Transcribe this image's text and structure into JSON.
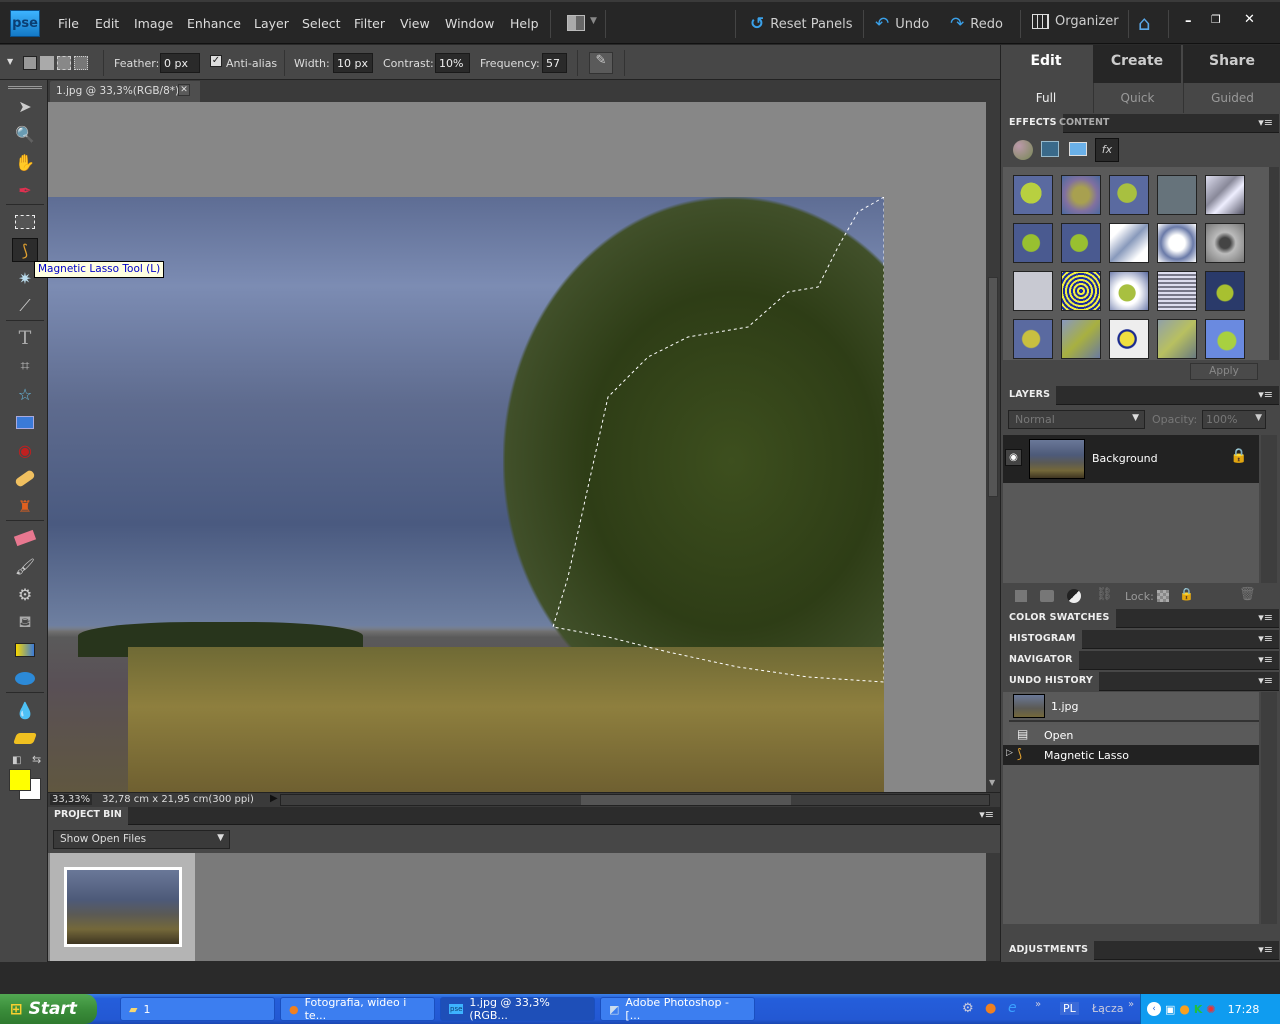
{
  "app": {
    "logo": "pse"
  },
  "menu": [
    "File",
    "Edit",
    "Image",
    "Enhance",
    "Layer",
    "Select",
    "Filter",
    "View",
    "Window",
    "Help"
  ],
  "toolbar": {
    "reset_panels": "Reset Panels",
    "undo": "Undo",
    "redo": "Redo",
    "organizer": "Organizer"
  },
  "options": {
    "feather_label": "Feather:",
    "feather_value": "0 px",
    "antialias_label": "Anti-alias",
    "antialias_checked": true,
    "width_label": "Width:",
    "width_value": "10 px",
    "contrast_label": "Contrast:",
    "contrast_value": "10%",
    "frequency_label": "Frequency:",
    "frequency_value": "57"
  },
  "document": {
    "tab_title": "1.jpg @ 33,3%(RGB/8*) *",
    "zoom": "33,33%",
    "doc_info": "32,78 cm x 21,95 cm(300 ppi)"
  },
  "tooltip": "Magnetic Lasso Tool  (L)",
  "tools": [
    "move",
    "zoom",
    "hand",
    "eyedropper",
    "rectangular-marquee",
    "magnetic-lasso",
    "magic-wand",
    "quick-selection",
    "type",
    "crop",
    "cookie-cutter",
    "straighten",
    "red-eye",
    "spot-healing",
    "clone-stamp",
    "eraser",
    "brush",
    "smart-brush",
    "paint-bucket",
    "gradient",
    "ellipse",
    "blur",
    "sponge"
  ],
  "colors": {
    "foreground": "#ffff00",
    "background": "#ffffff"
  },
  "project_bin": {
    "title": "PROJECT BIN",
    "dropdown": "Show Open Files"
  },
  "right": {
    "modes": [
      "Edit",
      "Create",
      "Share"
    ],
    "active_mode": "Edit",
    "submodes": [
      "Full",
      "Quick",
      "Guided"
    ],
    "active_submode": "Full",
    "effects_tabs": [
      "EFFECTS",
      "CONTENT"
    ],
    "apply": "Apply",
    "layers": {
      "title": "LAYERS",
      "blend_mode": "Normal",
      "opacity_label": "Opacity:",
      "opacity_value": "100%",
      "items": [
        {
          "name": "Background",
          "locked": true,
          "visible": true
        }
      ],
      "lock_label": "Lock:"
    },
    "collapsed_panels": [
      "COLOR SWATCHES",
      "HISTOGRAM",
      "NAVIGATOR"
    ],
    "undo_history": {
      "title": "UNDO HISTORY",
      "snapshot": "1.jpg",
      "steps": [
        "Open",
        "Magnetic Lasso"
      ],
      "current": "Magnetic Lasso"
    },
    "adjustments": "ADJUSTMENTS"
  },
  "taskbar": {
    "start": "Start",
    "tasks": [
      {
        "label": "1",
        "icon": "folder"
      },
      {
        "label": "Fotografia, wideo i te...",
        "icon": "firefox"
      },
      {
        "label": "1.jpg @ 33,3% (RGB...",
        "icon": "pse",
        "active": true
      },
      {
        "label": "Adobe Photoshop - [...",
        "icon": "photoshop"
      }
    ],
    "lang": "PL",
    "links": "Łącza",
    "clock": "17:28"
  }
}
